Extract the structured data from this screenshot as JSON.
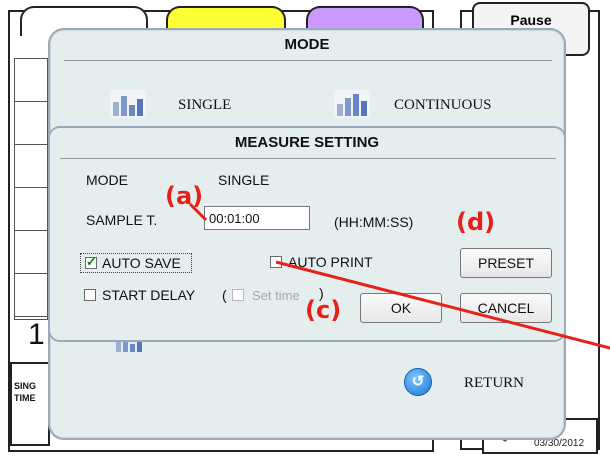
{
  "background": {
    "counter": "1",
    "bottom_text_line1": "SING",
    "bottom_text_line2": "TIME",
    "pause_label": "Pause",
    "time_fragment": "3",
    "date": "03/30/2012"
  },
  "mode_dialog": {
    "title": "MODE",
    "options": [
      {
        "label": "SINGLE",
        "icon": "bar-chart-icon"
      },
      {
        "label": "CONTINUOUS",
        "icon": "bar-chart-icon"
      }
    ],
    "return_label": "RETURN"
  },
  "measure_dialog": {
    "title": "MEASURE SETTING",
    "mode_label": "MODE",
    "mode_value": "SINGLE",
    "sample_label": "SAMPLE T.",
    "sample_value": "00:01:00",
    "sample_unit": "(HH:MM:SS)",
    "auto_save_label": "AUTO SAVE",
    "auto_save_checked": true,
    "auto_print_label": "AUTO PRINT",
    "auto_print_checked": false,
    "start_delay_label": "START DELAY",
    "start_delay_checked": false,
    "set_time_open": "(",
    "set_time_label": "Set time",
    "set_time_close": ")",
    "preset_label": "PRESET",
    "ok_label": "OK",
    "cancel_label": "CANCEL"
  },
  "annotations": {
    "a": "(a)",
    "c": "(c)",
    "d": "(d)",
    "color": "#e8201a"
  }
}
